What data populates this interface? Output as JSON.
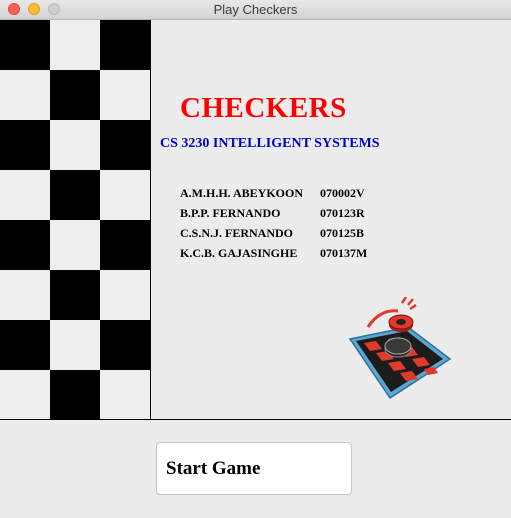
{
  "window": {
    "title": "Play Checkers"
  },
  "header": {
    "game_title": "CHECKERS",
    "course_title": "CS 3230 INTELLIGENT SYSTEMS"
  },
  "team_members": [
    {
      "name": "A.M.H.H. ABEYKOON",
      "id": "070002V"
    },
    {
      "name": "B.P.P. FERNANDO",
      "id": "070123R"
    },
    {
      "name": "C.S.N.J. FERNANDO",
      "id": "070125B"
    },
    {
      "name": "K.C.B. GAJASINGHE",
      "id": "070137M"
    }
  ],
  "footer": {
    "start_label": "Start Game"
  },
  "colors": {
    "title_red": "#ff0000",
    "course_blue": "#0000cc",
    "board_dark": "#000000",
    "board_light": "#eeeeee"
  },
  "icons": {
    "logo": "checkers-logo-icon"
  }
}
